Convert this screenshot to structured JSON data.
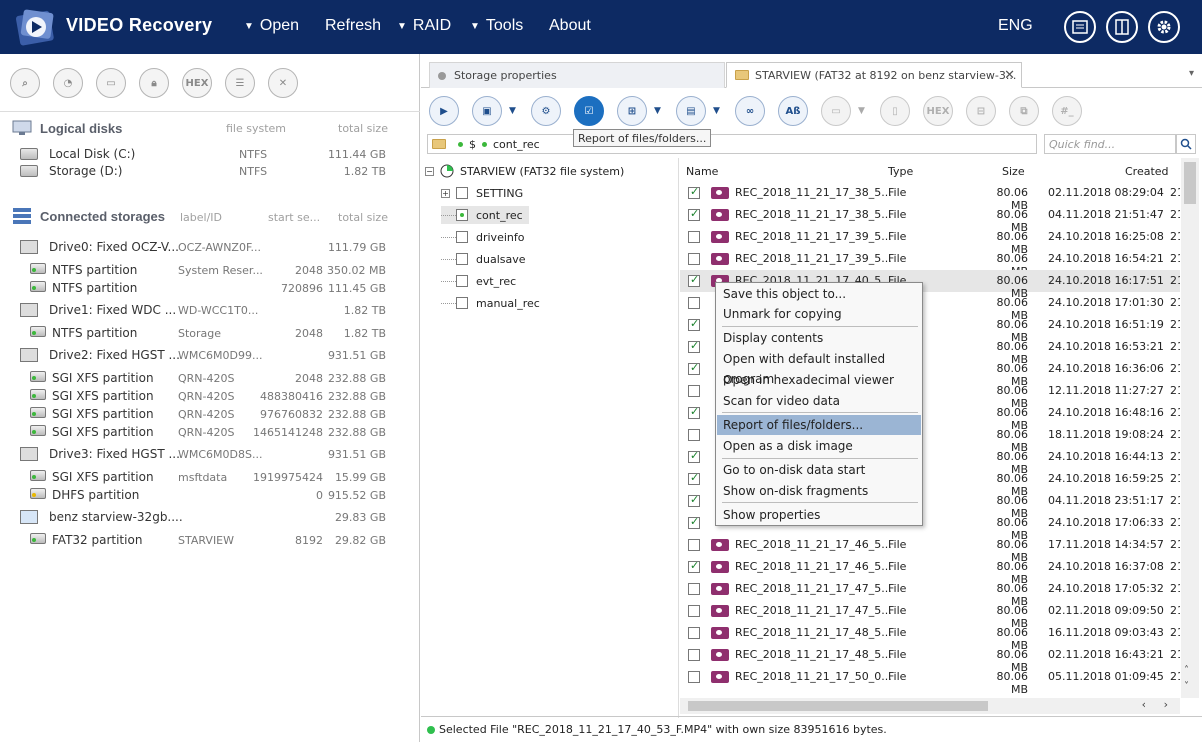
{
  "app": {
    "title": "VIDEO Recovery",
    "menu": [
      {
        "label": "Open",
        "has_dropdown": true
      },
      {
        "label": "Refresh",
        "has_dropdown": false
      },
      {
        "label": "RAID",
        "has_dropdown": true
      },
      {
        "label": "Tools",
        "has_dropdown": true
      },
      {
        "label": "About",
        "has_dropdown": false
      }
    ],
    "language": "ENG",
    "top_buttons": [
      "log-icon",
      "panels-icon",
      "settings-gear-icon"
    ]
  },
  "left_panel": {
    "toolbar_icons": [
      "zoom-icon",
      "scan-icon",
      "image-icon",
      "lock-icon",
      "hex-icon",
      "list-icon",
      "close-icon"
    ],
    "hex_label": "HEX",
    "logical": {
      "title": "Logical disks",
      "col_fs": "file system",
      "col_size": "total size",
      "items": [
        {
          "name": "Local Disk (C:)",
          "fs": "NTFS",
          "size": "111.44 GB"
        },
        {
          "name": "Storage (D:)",
          "fs": "NTFS",
          "size": "1.82 TB"
        }
      ]
    },
    "connected": {
      "title": "Connected storages",
      "col_label": "label/ID",
      "col_start": "start se...",
      "col_size": "total size",
      "items": [
        {
          "kind": "drive",
          "name": "Drive0: Fixed OCZ-V...",
          "label": "OCZ-AWNZ0F...",
          "start": "",
          "size": "111.79 GB"
        },
        {
          "kind": "part",
          "name": "NTFS partition",
          "label": "System Reser...",
          "start": "2048",
          "size": "350.02 MB"
        },
        {
          "kind": "part",
          "name": "NTFS partition",
          "label": "",
          "start": "720896",
          "size": "111.45 GB"
        },
        {
          "kind": "drive",
          "name": "Drive1: Fixed WDC ...",
          "label": "WD-WCC1T0...",
          "start": "",
          "size": "1.82 TB"
        },
        {
          "kind": "part",
          "name": "NTFS partition",
          "label": "Storage",
          "start": "2048",
          "size": "1.82 TB"
        },
        {
          "kind": "drive",
          "name": "Drive2: Fixed HGST ...",
          "label": "WMC6M0D99...",
          "start": "",
          "size": "931.51 GB"
        },
        {
          "kind": "part",
          "name": "SGI XFS partition",
          "label": "QRN-420S",
          "start": "2048",
          "size": "232.88 GB"
        },
        {
          "kind": "part",
          "name": "SGI XFS partition",
          "label": "QRN-420S",
          "start": "488380416",
          "size": "232.88 GB"
        },
        {
          "kind": "part",
          "name": "SGI XFS partition",
          "label": "QRN-420S",
          "start": "976760832",
          "size": "232.88 GB"
        },
        {
          "kind": "part",
          "name": "SGI XFS partition",
          "label": "QRN-420S",
          "start": "1465141248",
          "size": "232.88 GB"
        },
        {
          "kind": "drive",
          "name": "Drive3: Fixed HGST ...",
          "label": "WMC6M0D8S...",
          "start": "",
          "size": "931.51 GB"
        },
        {
          "kind": "part",
          "name": "SGI XFS partition",
          "label": "msftdata",
          "start": "1919975424",
          "size": "15.99 GB"
        },
        {
          "kind": "part-y",
          "name": "DHFS partition",
          "label": "",
          "start": "0",
          "size": "915.52 GB"
        },
        {
          "kind": "usb",
          "name": "benz starview-32gb....",
          "label": "",
          "start": "",
          "size": "29.83 GB"
        },
        {
          "kind": "part",
          "name": "FAT32 partition",
          "label": "STARVIEW",
          "start": "8192",
          "size": "29.82 GB"
        }
      ]
    }
  },
  "right_panel": {
    "tabs": [
      {
        "label": "Storage properties",
        "active": false
      },
      {
        "label": "STARVIEW (FAT32 at 8192 on benz starview-3...",
        "active": true
      }
    ],
    "toolbar_hex": "HEX",
    "toolbar_ab": "Aß",
    "toolbar_hash": "#_",
    "tooltip": "Report of files/folders...",
    "path": {
      "root": "$",
      "folder": "cont_rec"
    },
    "find_placeholder": "Quick find...",
    "tree": {
      "root": "STARVIEW (FAT32 file system)",
      "folders": [
        "SETTING",
        "cont_rec",
        "driveinfo",
        "dualsave",
        "evt_rec",
        "manual_rec"
      ]
    },
    "columns": {
      "name": "Name",
      "type": "Type",
      "size": "Size",
      "created": "Created"
    },
    "files": [
      {
        "checked": true,
        "name": "REC_2018_11_21_17_38_5...",
        "type": "File",
        "size": "80.06 MB",
        "created": "02.11.2018 08:29:04",
        "mod": "21"
      },
      {
        "checked": true,
        "name": "REC_2018_11_21_17_38_5...",
        "type": "File",
        "size": "80.06 MB",
        "created": "04.11.2018 21:51:47",
        "mod": "21"
      },
      {
        "checked": false,
        "name": "REC_2018_11_21_17_39_5...",
        "type": "File",
        "size": "80.06 MB",
        "created": "24.10.2018 16:25:08",
        "mod": "21"
      },
      {
        "checked": false,
        "name": "REC_2018_11_21_17_39_5...",
        "type": "File",
        "size": "80.06 MB",
        "created": "24.10.2018 16:54:21",
        "mod": "21"
      },
      {
        "checked": true,
        "name": "REC_2018_11_21_17_40_5...",
        "type": "File",
        "size": "80.06 MB",
        "created": "24.10.2018 16:17:51",
        "mod": "21",
        "selected": true
      },
      {
        "checked": false,
        "name": "",
        "type": "",
        "size": "80.06 MB",
        "created": "24.10.2018 17:01:30",
        "mod": "21"
      },
      {
        "checked": true,
        "name": "",
        "type": "",
        "size": "80.06 MB",
        "created": "24.10.2018 16:51:19",
        "mod": "21"
      },
      {
        "checked": true,
        "name": "",
        "type": "",
        "size": "80.06 MB",
        "created": "24.10.2018 16:53:21",
        "mod": "21"
      },
      {
        "checked": true,
        "name": "",
        "type": "",
        "size": "80.06 MB",
        "created": "24.10.2018 16:36:06",
        "mod": "21"
      },
      {
        "checked": false,
        "name": "",
        "type": "",
        "size": "80.06 MB",
        "created": "12.11.2018 11:27:27",
        "mod": "21"
      },
      {
        "checked": true,
        "name": "",
        "type": "",
        "size": "80.06 MB",
        "created": "24.10.2018 16:48:16",
        "mod": "21"
      },
      {
        "checked": false,
        "name": "",
        "type": "",
        "size": "80.06 MB",
        "created": "18.11.2018 19:08:24",
        "mod": "21"
      },
      {
        "checked": true,
        "name": "",
        "type": "",
        "size": "80.06 MB",
        "created": "24.10.2018 16:44:13",
        "mod": "21"
      },
      {
        "checked": true,
        "name": "",
        "type": "",
        "size": "80.06 MB",
        "created": "24.10.2018 16:59:25",
        "mod": "21"
      },
      {
        "checked": true,
        "name": "",
        "type": "",
        "size": "80.06 MB",
        "created": "04.11.2018 23:51:17",
        "mod": "21"
      },
      {
        "checked": true,
        "name": "",
        "type": "",
        "size": "80.06 MB",
        "created": "24.10.2018 17:06:33",
        "mod": "21"
      },
      {
        "checked": false,
        "name": "REC_2018_11_21_17_46_5...",
        "type": "File",
        "size": "80.06 MB",
        "created": "17.11.2018 14:34:57",
        "mod": "21"
      },
      {
        "checked": true,
        "name": "REC_2018_11_21_17_46_5...",
        "type": "File",
        "size": "80.06 MB",
        "created": "24.10.2018 16:37:08",
        "mod": "21"
      },
      {
        "checked": false,
        "name": "REC_2018_11_21_17_47_5...",
        "type": "File",
        "size": "80.06 MB",
        "created": "24.10.2018 17:05:32",
        "mod": "21"
      },
      {
        "checked": false,
        "name": "REC_2018_11_21_17_47_5...",
        "type": "File",
        "size": "80.06 MB",
        "created": "02.11.2018 09:09:50",
        "mod": "21"
      },
      {
        "checked": false,
        "name": "REC_2018_11_21_17_48_5...",
        "type": "File",
        "size": "80.06 MB",
        "created": "16.11.2018 09:03:43",
        "mod": "21"
      },
      {
        "checked": false,
        "name": "REC_2018_11_21_17_48_5...",
        "type": "File",
        "size": "80.06 MB",
        "created": "02.11.2018 16:43:21",
        "mod": "21"
      },
      {
        "checked": false,
        "name": "REC_2018_11_21_17_50_0...",
        "type": "File",
        "size": "80.06 MB",
        "created": "05.11.2018 01:09:45",
        "mod": "21"
      }
    ],
    "status": "Selected File \"REC_2018_11_21_17_40_53_F.MP4\" with own size 83951616 bytes."
  },
  "context_menu": {
    "items": [
      "Save this object to...",
      "Unmark for copying",
      "Display contents",
      "Open with default installed program",
      "Open in hexadecimal viewer",
      "Scan for video data",
      "Report of files/folders...",
      "Open as a disk image",
      "Go to on-disk data start",
      "Show on-disk fragments",
      "Show properties"
    ],
    "highlighted": "Report of files/folders..."
  },
  "colors": {
    "topbar": "#0d2a63",
    "accent": "#1c6fc0",
    "highlight": "#9bb5d4",
    "video_icon": "#8f2f6e"
  }
}
